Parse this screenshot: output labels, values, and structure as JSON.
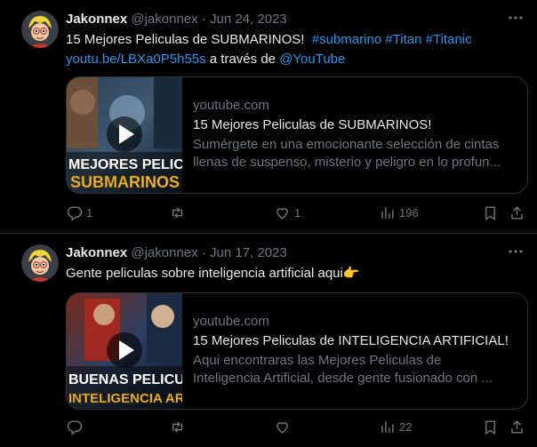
{
  "tweets": [
    {
      "author": "Jakonnex",
      "handle": "@jakonnex",
      "separator": "·",
      "date": "Jun 24, 2023",
      "text_plain": "15 Mejores Peliculas de SUBMARINOS!",
      "hashtags": [
        "#submarino",
        "#Titan",
        "#Titanic"
      ],
      "link": "youtu.be/LBXa0P5h55s",
      "via_text": "a través de",
      "mention": "@YouTube",
      "card": {
        "domain": "youtube.com",
        "title": "15 Mejores Peliculas de SUBMARINOS!",
        "description_line1": "Sumérgete en una emocionante selección de cintas",
        "description_line2": "llenas de suspenso, misterio y peligro en lo profun...",
        "thumbnail_text_1": "MEJORES PELICU",
        "thumbnail_text_2": "SUBMARINOS"
      },
      "replies": "1",
      "reposts": "",
      "likes": "1",
      "views": "196"
    },
    {
      "author": "Jakonnex",
      "handle": "@jakonnex",
      "separator": "·",
      "date": "Jun 17, 2023",
      "text_plain": "Gente peliculas sobre inteligencia artificial aqui",
      "emoji": "👉",
      "card": {
        "domain": "youtube.com",
        "title": "15 Mejores Peliculas de INTELIGENCIA ARTIFICIAL!",
        "description_line1": "Aqui encontraras las Mejores Peliculas de",
        "description_line2": "Inteligencia Artificial, desde gente fusionado con ...",
        "thumbnail_text_1": "BUENAS PELICU",
        "thumbnail_text_2": "INTELIGENCIA ARTIF"
      },
      "replies": "",
      "reposts": "",
      "likes": "",
      "views": "22"
    }
  ],
  "icons": [
    "more-icon",
    "reply-icon",
    "repost-icon",
    "like-icon",
    "views-icon",
    "bookmark-icon",
    "share-icon",
    "play-icon"
  ],
  "colors": {
    "background": "#000000",
    "text": "#e7e9ea",
    "muted": "#71767b",
    "link": "#1d9bf0",
    "border": "#2f3336"
  }
}
